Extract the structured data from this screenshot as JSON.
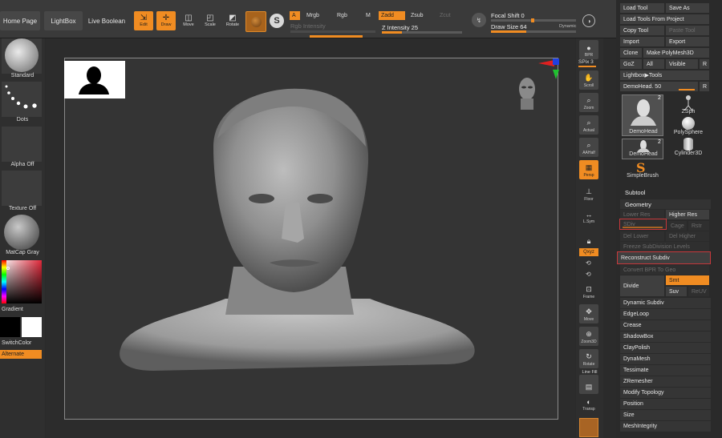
{
  "topbar": {
    "home_page": "Home Page",
    "lightbox": "LightBox",
    "live_boolean": "Live Boolean",
    "edit": "Edit",
    "draw": "Draw",
    "move": "Move",
    "scale": "Scale",
    "rotate": "Rotate",
    "a_label": "A",
    "mrgb": "Mrgb",
    "rgb": "Rgb",
    "m": "M",
    "zadd": "Zadd",
    "zsub": "Zsub",
    "zcut": "Zcut",
    "rgb_intensity": "Rgb Intensity",
    "z_intensity": "Z Intensity 25",
    "focal_shift": "Focal Shift 0",
    "draw_size": "Draw Size 64",
    "dynamic": "Dynamic"
  },
  "left": {
    "standard": "Standard",
    "dots": "Dots",
    "alpha_off": "Alpha Off",
    "texture_off": "Texture Off",
    "matcap": "MatCap Gray",
    "gradient": "Gradient",
    "switch_color": "SwitchColor",
    "alternate": "Alternate"
  },
  "shelf": [
    "BPR",
    "SPix 3",
    "Scroll",
    "Zoom",
    "Actual",
    "AAHalf",
    "Persp",
    "Floor",
    "L.Sym",
    "Qxyz",
    "Frame",
    "Move",
    "Zoom3D",
    "Rotate",
    "Line Fill",
    "Transp"
  ],
  "tool": {
    "load_tool": "Load Tool",
    "save_as": "Save As",
    "load_from_project": "Load Tools From Project",
    "copy_tool": "Copy Tool",
    "paste_tool": "Paste Tool",
    "import": "Import",
    "export": "Export",
    "clone": "Clone",
    "make_polymesh": "Make PolyMesh3D",
    "goz": "GoZ",
    "all": "All",
    "visible": "Visible",
    "r": "R",
    "lightbox_tools": "Lightbox▶Tools",
    "demohead_slider": "DemoHead. 50",
    "demohead_thumb": "DemoHead",
    "count_2": "2",
    "zsph": "ZSph",
    "polysphere": "PolySphere",
    "demohead_small": "DemoHead",
    "cylinder": "Cylinder3D",
    "simplebrush": "SimpleBrush"
  },
  "subtool": "Subtool",
  "geometry": {
    "title": "Geometry",
    "lower_res": "Lower Res",
    "higher_res": "Higher Res",
    "sdiv": "SDiv",
    "cage": "Cage",
    "rstr": "Rstr",
    "del_lower": "Del Lower",
    "del_higher": "Del Higher",
    "freeze": "Freeze SubDivision Levels",
    "reconstruct": "Reconstruct Subdiv",
    "convert_bpr": "Convert BPR To Geo",
    "divide": "Divide",
    "smt": "Smt",
    "suv": "Suv",
    "reluv": "ReUV",
    "items": [
      "Dynamic Subdiv",
      "EdgeLoop",
      "Crease",
      "ShadowBox",
      "ClayPolish",
      "DynaMesh",
      "Tessimate",
      "ZRemesher",
      "Modify Topology",
      "Position",
      "Size",
      "MeshIntegrity"
    ]
  },
  "colors": {
    "accent": "#f08c22",
    "highlight": "#c8383b"
  }
}
